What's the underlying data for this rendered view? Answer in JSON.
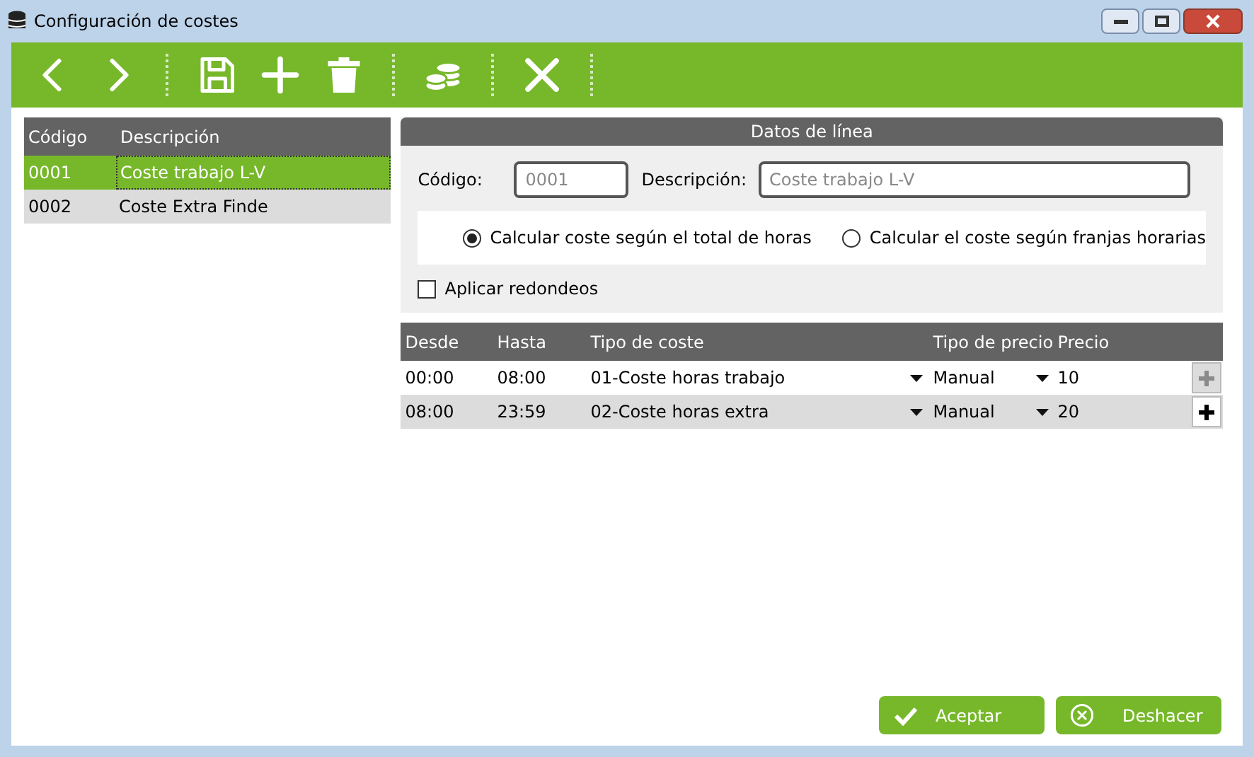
{
  "window": {
    "title": "Configuración de costes"
  },
  "toolbar": [
    {
      "kind": "back"
    },
    {
      "kind": "forward"
    },
    {
      "kind": "separator"
    },
    {
      "kind": "save"
    },
    {
      "kind": "add"
    },
    {
      "kind": "delete"
    },
    {
      "kind": "separator"
    },
    {
      "kind": "coins"
    },
    {
      "kind": "separator"
    },
    {
      "kind": "close"
    },
    {
      "kind": "separator"
    }
  ],
  "list": {
    "columns": [
      "Código",
      "Descripción"
    ],
    "rows": [
      {
        "code": "0001",
        "description": "Coste trabajo L-V",
        "selected": true
      },
      {
        "code": "0002",
        "description": "Coste Extra Finde",
        "selected": false
      }
    ]
  },
  "line_data": {
    "title": "Datos de línea",
    "code_label": "Código:",
    "code_placeholder": "0001",
    "description_label": "Descripción:",
    "description_placeholder": "Coste trabajo L-V",
    "radios": [
      {
        "label": "Calcular coste según el total de horas",
        "selected": true
      },
      {
        "label": "Calcular el coste según franjas horarias",
        "selected": false
      }
    ],
    "rounding": {
      "label": "Aplicar redondeos",
      "checked": false
    }
  },
  "bands": {
    "columns": [
      "Desde",
      "Hasta",
      "Tipo de coste",
      "Tipo de precio",
      "Precio"
    ],
    "rows": [
      {
        "from": "00:00",
        "to": "08:00",
        "cost_type": "01-Coste horas trabajo",
        "price_type": "Manual",
        "price": "10",
        "add_disabled": true
      },
      {
        "from": "08:00",
        "to": "23:59",
        "cost_type": "02-Coste horas extra",
        "price_type": "Manual",
        "price": "20",
        "add_disabled": false
      }
    ]
  },
  "buttons": [
    {
      "kind": "accept",
      "label": "Aceptar"
    },
    {
      "kind": "undo",
      "label": "Deshacer"
    }
  ]
}
